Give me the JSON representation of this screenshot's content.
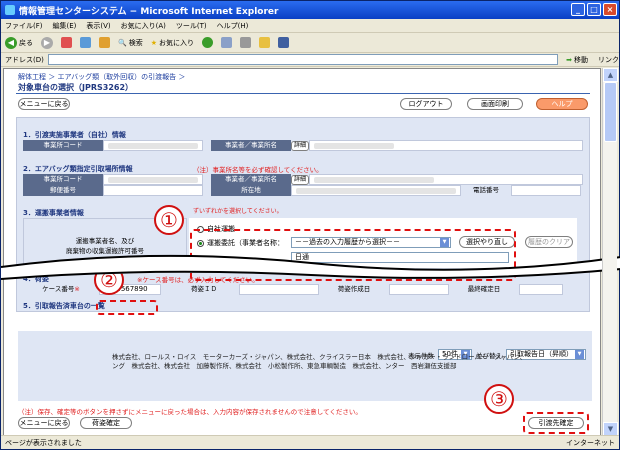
{
  "window": {
    "title": "情報管理センターシステム − Microsoft Internet Explorer",
    "controls": [
      "_",
      "□",
      "×"
    ]
  },
  "menubar": [
    "ファイル(F)",
    "編集(E)",
    "表示(V)",
    "お気に入り(A)",
    "ツール(T)",
    "ヘルプ(H)"
  ],
  "toolbar": {
    "back": "戻る",
    "search": "検索",
    "favorites": "お気に入り"
  },
  "addressbar": {
    "label": "アドレス(D)",
    "go": "移動",
    "links": "リンク"
  },
  "page": {
    "breadcrumb": "解体工程 ＞ エアバッグ類（取外回収）の引渡報告 ＞",
    "title": "対象車台の選択（JPRS3262）",
    "menu_back": "メニューに戻る",
    "logout": "ログアウト",
    "print": "画面印刷",
    "help": "ヘルプ",
    "sec1": {
      "heading": "1．引渡実施事業者（自社）情報",
      "code_label": "事業所コード",
      "name_label": "事業者／事業所名",
      "detail": "詳細"
    },
    "sec2": {
      "heading": "2．エアバッグ類指定引取場所情報",
      "note": "（注）事業所名等を必ず確認してください。",
      "code_label": "事業所コード",
      "name_label": "事業者／事業所名",
      "detail": "詳細",
      "zip_label": "郵便番号",
      "addr_label": "所在地",
      "tel_label": "電話番号"
    },
    "sec3": {
      "heading": "3．運搬事業者情報",
      "note": "ずいずれかを選択してください。",
      "label_line1": "運搬事業者名、及び",
      "label_line2": "廃棄物の収集運搬許可番号",
      "radio_self": "自社運搬",
      "radio_consign": "運搬委託（事業者名称：",
      "select_value": "－－過去の入力履歴から選択－－",
      "redo_button": "選択やり直し",
      "clear_button": "履歴のクリア",
      "consignee_value": "日通"
    },
    "sec4": {
      "heading": "4．荷姿",
      "note": "※ケース番号は、必ず入力してください。",
      "case_label": "ケース番号",
      "case_value": "1234567890",
      "id_label": "荷姿ＩＤ",
      "date_label": "荷姿作成日",
      "final_label": "最終確定日"
    },
    "sec5": {
      "heading": "5．引取報告済車台の一覧",
      "count_label": "表示件数",
      "count_value": "50件",
      "sort_label": "並び替え",
      "sort_value": "引取報告日（昇順）",
      "companies": "株式会社、ロールス・ロイス　モーターカーズ・ジャパン、株式会社、クライスラー日本　株式会社、ジャガー・ランドローバー・ジャパン、ング　株式会社、株式会社　加藤製作所、株式会社　小松製作所、東急車輌製造　株式会社、ンター　西岩瀬伍支援部"
    },
    "footer_note": "（注）保存、確定等のボタンを押さずにメニューに戻った場合は、入力内容が保存されませんので注意してください。",
    "menu_back2": "メニューに戻る",
    "pack_confirm": "荷姿確定",
    "delivery_confirm": "引渡先確定"
  },
  "callouts": [
    "①",
    "②",
    "③"
  ],
  "status": {
    "left": "ページが表示されました",
    "right": "インターネット"
  }
}
